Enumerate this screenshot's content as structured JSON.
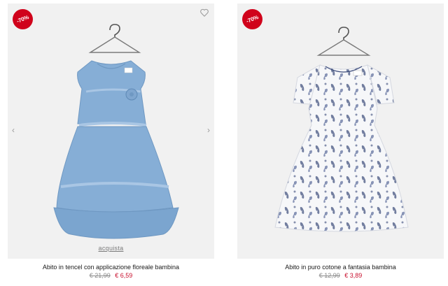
{
  "products": [
    {
      "discount_badge": "-70%",
      "name": "Abito in tencel con applicazione floreale bambina",
      "old_price": "€ 21,99",
      "new_price": "€ 6,59",
      "buy_label": "acquista",
      "wishlist_icon": "heart-outline-icon",
      "prev_icon": "chevron-left-icon",
      "next_icon": "chevron-right-icon"
    },
    {
      "discount_badge": "-70%",
      "name": "Abito in puro cotone a fantasia bambina",
      "old_price": "€ 12,99",
      "new_price": "€ 3,89"
    }
  ],
  "colors": {
    "badge": "#d0021b",
    "sale_price": "#c8102e",
    "denim_dress": "#86aed6",
    "print_dress_bg": "#f6f7f9",
    "print_butterflies": "#3a4a7a"
  }
}
